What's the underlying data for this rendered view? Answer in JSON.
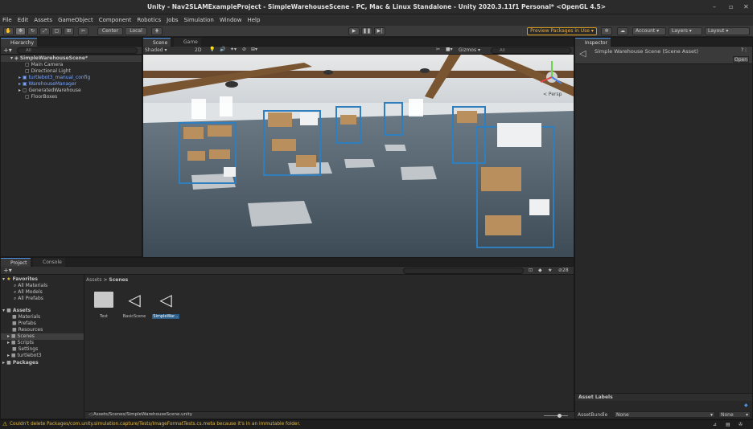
{
  "window": {
    "title": "Unity - Nav2SLAMExampleProject - SimpleWarehouseScene - PC, Mac & Linux Standalone - Unity 2020.3.11f1 Personal* <OpenGL 4.5>"
  },
  "menu": [
    "File",
    "Edit",
    "Assets",
    "GameObject",
    "Component",
    "Robotics",
    "Jobs",
    "Simulation",
    "Window",
    "Help"
  ],
  "toolbar": {
    "center": "Center",
    "local": "Local",
    "preview": "Preview Packages in Use",
    "account": "Account",
    "layers": "Layers",
    "layout": "Layout"
  },
  "hierarchy": {
    "tab": "Hierarchy",
    "search": "All",
    "scene": "SimpleWarehouseScene*",
    "items": [
      "Main Camera",
      "Directional Light",
      "turtlebot3_manual_config",
      "WarehouseManager",
      "GeneratedWarehouse",
      "FloorBoxes"
    ]
  },
  "scene": {
    "tab_scene": "Scene",
    "tab_game": "Game",
    "shading": "Shaded",
    "mode2d": "2D",
    "gizmos": "Gizmos",
    "search": "All",
    "persp": "< Persp"
  },
  "inspector": {
    "tab": "Inspector",
    "title": "Simple Warehouse Scene (Scene Asset)",
    "open": "Open",
    "asset_labels": "Asset Labels",
    "asset_bundle": "AssetBundle",
    "bundle_val": "None",
    "variant_val": "None"
  },
  "project": {
    "tab_project": "Project",
    "tab_console": "Console",
    "favorites": "Favorites",
    "fav_items": [
      "All Materials",
      "All Models",
      "All Prefabs"
    ],
    "assets": "Assets",
    "asset_items": [
      "Materials",
      "Prefabs",
      "Resources",
      "Scenes",
      "Scripts",
      "Settings",
      "turtlebot3"
    ],
    "packages": "Packages",
    "crumb1": "Assets",
    "crumb2": "Scenes",
    "count": "28",
    "files": [
      "Test",
      "BasicScene",
      "SimpleWar..."
    ],
    "path": "Assets/Scenes/SimpleWarehouseScene.unity"
  },
  "status": {
    "message": "Couldn't delete Packages/com.unity.simulation.capture/Tests/ImageFormatTests.cs.meta because it's in an immutable folder."
  }
}
